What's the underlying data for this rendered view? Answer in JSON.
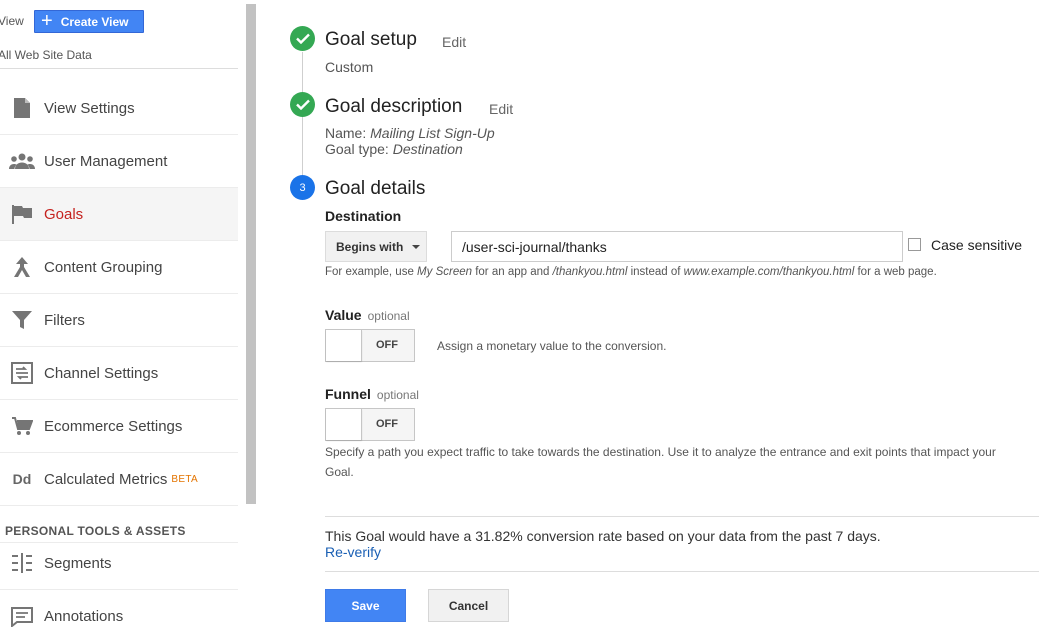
{
  "sidebar": {
    "view_label": "View",
    "create_view_label": "Create View",
    "view_name": "All Web Site Data",
    "items": [
      {
        "label": "View Settings",
        "icon": "document-icon"
      },
      {
        "label": "User Management",
        "icon": "users-icon"
      },
      {
        "label": "Goals",
        "icon": "flag-icon",
        "active": true
      },
      {
        "label": "Content Grouping",
        "icon": "grouping-icon"
      },
      {
        "label": "Filters",
        "icon": "filter-icon"
      },
      {
        "label": "Channel Settings",
        "icon": "channel-icon"
      },
      {
        "label": "Ecommerce Settings",
        "icon": "cart-icon"
      },
      {
        "label": "Calculated Metrics",
        "icon": "dd-icon",
        "badge": "BETA",
        "icon_text": "Dd"
      }
    ],
    "section_header": "PERSONAL TOOLS & ASSETS",
    "tools": [
      {
        "label": "Segments",
        "icon": "segments-icon"
      },
      {
        "label": "Annotations",
        "icon": "annotations-icon"
      }
    ]
  },
  "steps": {
    "setup": {
      "title": "Goal setup",
      "edit": "Edit",
      "value": "Custom"
    },
    "description": {
      "title": "Goal description",
      "edit": "Edit",
      "name_label": "Name:",
      "name_value": "Mailing List Sign-Up",
      "type_label": "Goal type:",
      "type_value": "Destination"
    },
    "details": {
      "number": "3",
      "title": "Goal details"
    }
  },
  "destination": {
    "label": "Destination",
    "match_type": "Begins with",
    "value": "/user-sci-journal/thanks",
    "case_sensitive_label": "Case sensitive",
    "example": {
      "p1": "For example, use ",
      "i1": "My Screen",
      "p2": " for an app and ",
      "i2": "/thankyou.html",
      "p3": " instead of ",
      "i3": "www.example.com/thankyou.html",
      "p4": " for a web page."
    }
  },
  "value_field": {
    "label": "Value",
    "optional": "optional",
    "toggle_state": "OFF",
    "help": "Assign a monetary value to the conversion."
  },
  "funnel_field": {
    "label": "Funnel",
    "optional": "optional",
    "toggle_state": "OFF",
    "help": "Specify a path you expect traffic to take towards the destination. Use it to analyze the entrance and exit points that impact your Goal."
  },
  "verify": {
    "text": "This Goal would have a 31.82% conversion rate based on your data from the past 7 days.",
    "link": "Re-verify"
  },
  "actions": {
    "save": "Save",
    "cancel": "Cancel"
  },
  "colors": {
    "primary_button": "#4285f4",
    "active_nav": "#c5221f",
    "step_complete": "#34a853",
    "step_current": "#1a73e8",
    "link": "#1a5fb4",
    "beta_badge": "#e37400"
  }
}
